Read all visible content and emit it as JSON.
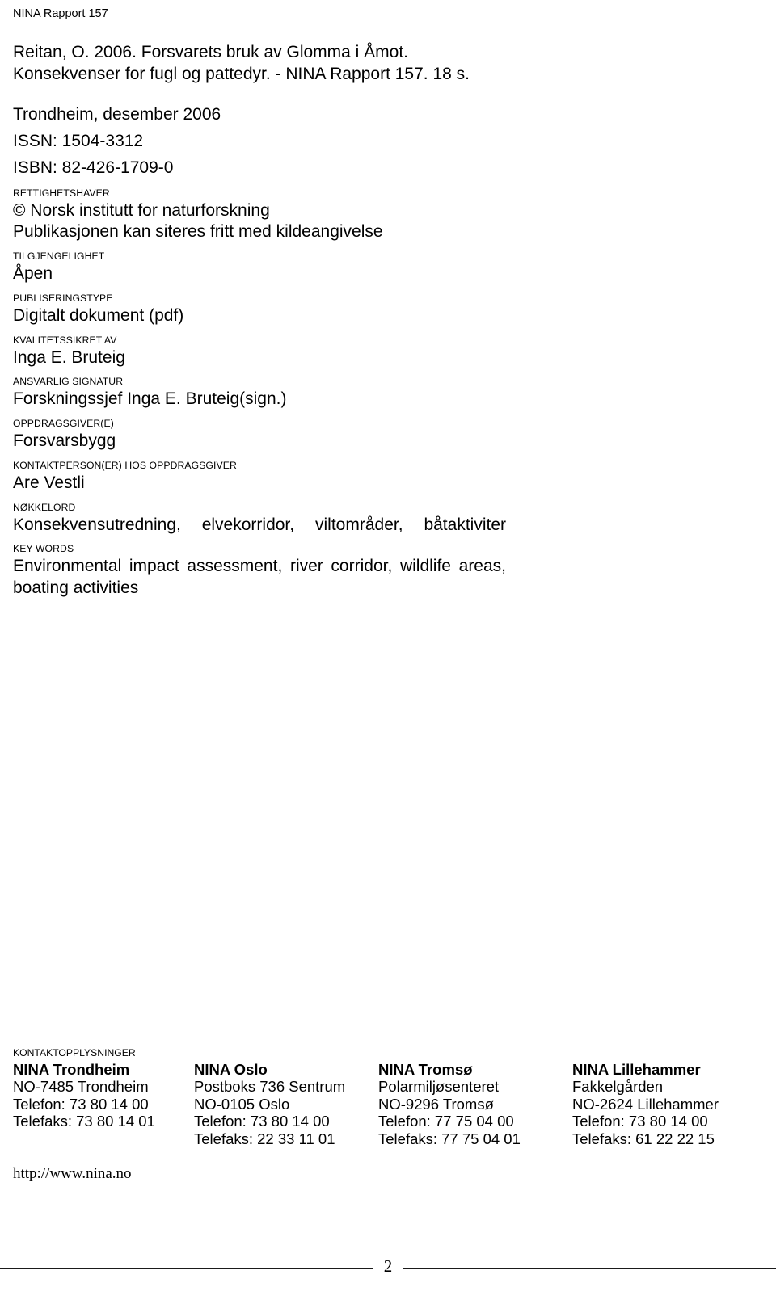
{
  "header": {
    "running_title": "NINA Rapport 157"
  },
  "citation": {
    "text": "Reitan, O. 2006. Forsvarets bruk av Glomma i Åmot. Konsekvenser for fugl og pattedyr. - NINA Rapport 157. 18 s."
  },
  "publication": {
    "place_date": "Trondheim, desember 2006",
    "issn": "ISSN: 1504-3312",
    "isbn": "ISBN: 82-426-1709-0"
  },
  "metadata": [
    {
      "label": "RETTIGHETSHAVER",
      "value": "© Norsk institutt for naturforskning",
      "value2": "Publikasjonen kan siteres fritt med kildeangivelse"
    },
    {
      "label": "TILGJENGELIGHET",
      "value": "Åpen"
    },
    {
      "label": "PUBLISERINGSTYPE",
      "value": "Digitalt dokument (pdf)"
    },
    {
      "label": "KVALITETSSIKRET AV",
      "value": "Inga E. Bruteig"
    },
    {
      "label": "ANSVARLIG SIGNATUR",
      "value": "Forskningssjef Inga E. Bruteig(sign.)"
    },
    {
      "label": "OPPDRAGSGIVER(E)",
      "value": "Forsvarsbygg"
    },
    {
      "label": "KONTAKTPERSON(ER) HOS OPPDRAGSGIVER",
      "value": "Are Vestli"
    },
    {
      "label": "NØKKELORD",
      "value": "Konsekvensutredning, elvekorridor, viltområder, båtaktiviter"
    },
    {
      "label": "KEY WORDS",
      "value": "Environmental impact assessment, river corridor, wildlife areas, boating activities"
    }
  ],
  "contact": {
    "label": "KONTAKTOPPLYSNINGER",
    "offices": [
      {
        "name": "NINA Trondheim",
        "lines": [
          "NO-7485 Trondheim",
          "Telefon: 73 80 14 00",
          "Telefaks: 73 80 14 01"
        ]
      },
      {
        "name": "NINA Oslo",
        "lines": [
          "Postboks 736 Sentrum",
          "NO-0105 Oslo",
          "Telefon: 73 80 14 00",
          "Telefaks: 22 33 11 01"
        ]
      },
      {
        "name": "NINA Tromsø",
        "lines": [
          "Polarmiljøsenteret",
          "NO-9296 Tromsø",
          "Telefon: 77 75 04 00",
          "Telefaks: 77 75 04 01"
        ]
      },
      {
        "name": "NINA Lillehammer",
        "lines": [
          "Fakkelgården",
          "NO-2624 Lillehammer",
          "Telefon: 73 80 14 00",
          "Telefaks: 61 22 22 15"
        ]
      }
    ],
    "website": "http://www.nina.no"
  },
  "footer": {
    "page_number": "2"
  }
}
